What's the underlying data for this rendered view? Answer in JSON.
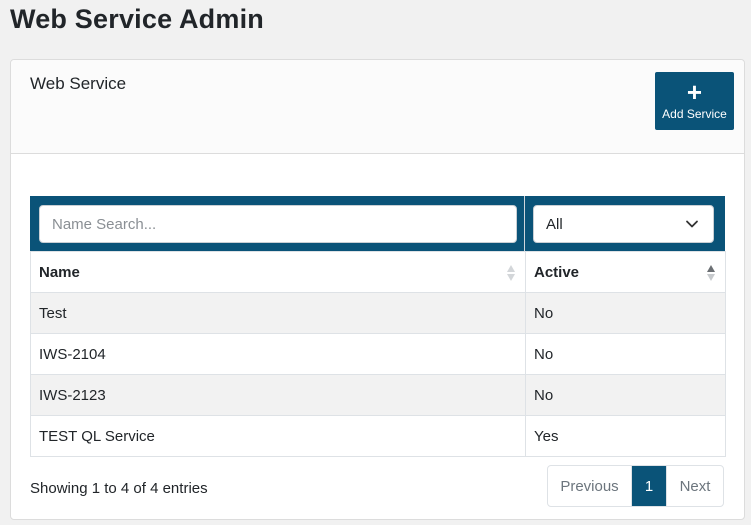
{
  "page": {
    "title": "Web Service Admin"
  },
  "card": {
    "title": "Web Service",
    "add_button": {
      "icon": "plus-icon",
      "glyph": "+",
      "label": "Add Service"
    }
  },
  "filters": {
    "name_search_placeholder": "Name Search...",
    "name_search_value": "",
    "active_select_value": "All"
  },
  "table": {
    "columns": [
      "Name",
      "Active"
    ],
    "rows": [
      {
        "name": "Test",
        "active": "No"
      },
      {
        "name": "IWS-2104",
        "active": "No"
      },
      {
        "name": "IWS-2123",
        "active": "No"
      },
      {
        "name": "TEST QL Service",
        "active": "Yes"
      }
    ]
  },
  "footer": {
    "info": "Showing 1 to 4 of 4 entries",
    "pagination": {
      "previous": "Previous",
      "current": "1",
      "next": "Next"
    }
  },
  "colors": {
    "accent": "#0a5378",
    "row_striped": "#f2f2f2"
  }
}
